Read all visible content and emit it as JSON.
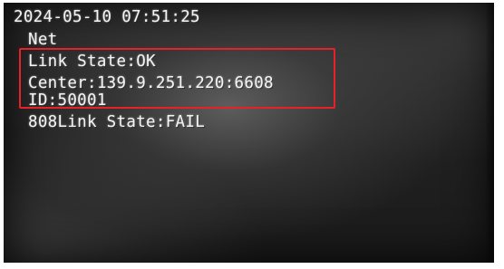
{
  "osd": {
    "timestamp": "2024-05-10 07:51:25",
    "section": "Net",
    "link_state": "Link State:OK",
    "center": "Center:139.9.251.220:6608",
    "id": "ID:50001",
    "link_808_state": "808Link State:FAIL"
  },
  "colors": {
    "osd_text": "#f4f4f4",
    "highlight_box": "#e8202a",
    "screen_background": "#222222"
  }
}
